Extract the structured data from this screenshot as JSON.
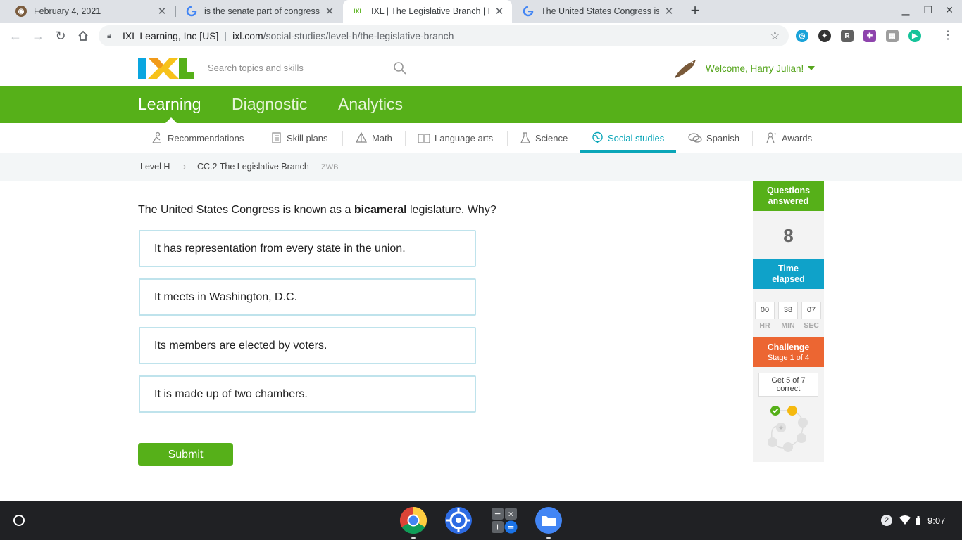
{
  "browser": {
    "tabs": [
      {
        "title": "February 4, 2021",
        "favicon": "owl-icon"
      },
      {
        "title": "is the senate part of congress - G",
        "favicon": "google-icon"
      },
      {
        "title": "IXL | The Legislative Branch | Lev",
        "favicon": "ixl-icon"
      },
      {
        "title": "The United States Congress is kn",
        "favicon": "google-icon"
      }
    ],
    "active_tab": 2,
    "address": {
      "org": "IXL Learning, Inc [US]",
      "domain": "ixl.com",
      "path": "/social-studies/level-h/the-legislative-branch"
    },
    "extensions": [
      "compass-icon",
      "puzzle-dark-icon",
      "r-icon",
      "puzzle-purple-icon",
      "puzzle-gray-icon",
      "grammarly-icon"
    ]
  },
  "ixl": {
    "search_placeholder": "Search topics and skills",
    "welcome": "Welcome, Harry Julian!",
    "main_nav": [
      "Learning",
      "Diagnostic",
      "Analytics"
    ],
    "active_main_nav": "Learning",
    "subject_nav": [
      {
        "label": "Recommendations",
        "icon": "recommendations-icon"
      },
      {
        "label": "Skill plans",
        "icon": "skill-plans-icon"
      },
      {
        "label": "Math",
        "icon": "math-icon"
      },
      {
        "label": "Language arts",
        "icon": "language-arts-icon"
      },
      {
        "label": "Science",
        "icon": "science-icon"
      },
      {
        "label": "Social studies",
        "icon": "social-studies-icon"
      },
      {
        "label": "Spanish",
        "icon": "spanish-icon"
      },
      {
        "label": "Awards",
        "icon": "awards-icon"
      }
    ],
    "active_subject": "Social studies",
    "breadcrumb": {
      "level": "Level H",
      "separator": "›",
      "skill": "CC.2 The Legislative Branch",
      "code": "ZWB"
    }
  },
  "question": {
    "prefix": "The United States Congress is known as a ",
    "bold": "bicameral",
    "suffix": " legislature. Why?",
    "choices": [
      "It has representation from every state in the union.",
      "It meets in Washington, D.C.",
      "Its members are elected by voters.",
      "It is made up of two chambers."
    ],
    "submit_label": "Submit"
  },
  "sidebar": {
    "questions_label_1": "Questions",
    "questions_label_2": "answered",
    "questions_answered": "8",
    "time_label_1": "Time",
    "time_label_2": "elapsed",
    "time": {
      "hr": "00",
      "min": "38",
      "sec": "07"
    },
    "time_units": {
      "hr": "HR",
      "min": "MIN",
      "sec": "SEC"
    },
    "challenge_title": "Challenge",
    "challenge_stage": "Stage 1 of 4",
    "goal_line1": "Get 5 of 7",
    "goal_line2": "correct",
    "progress": {
      "correct": 1,
      "current": 2,
      "total": 7
    }
  },
  "shelf": {
    "apps": [
      "chrome-icon",
      "screencastify-icon",
      "calculator-icon",
      "files-icon"
    ],
    "notification_count": "2",
    "time": "9:07"
  },
  "colors": {
    "ixl_green": "#56b019",
    "ixl_blue": "#0fa2c9",
    "ixl_orange": "#ec6632",
    "teal_active": "#0aa6b8",
    "choice_border": "#bfe3ec"
  }
}
